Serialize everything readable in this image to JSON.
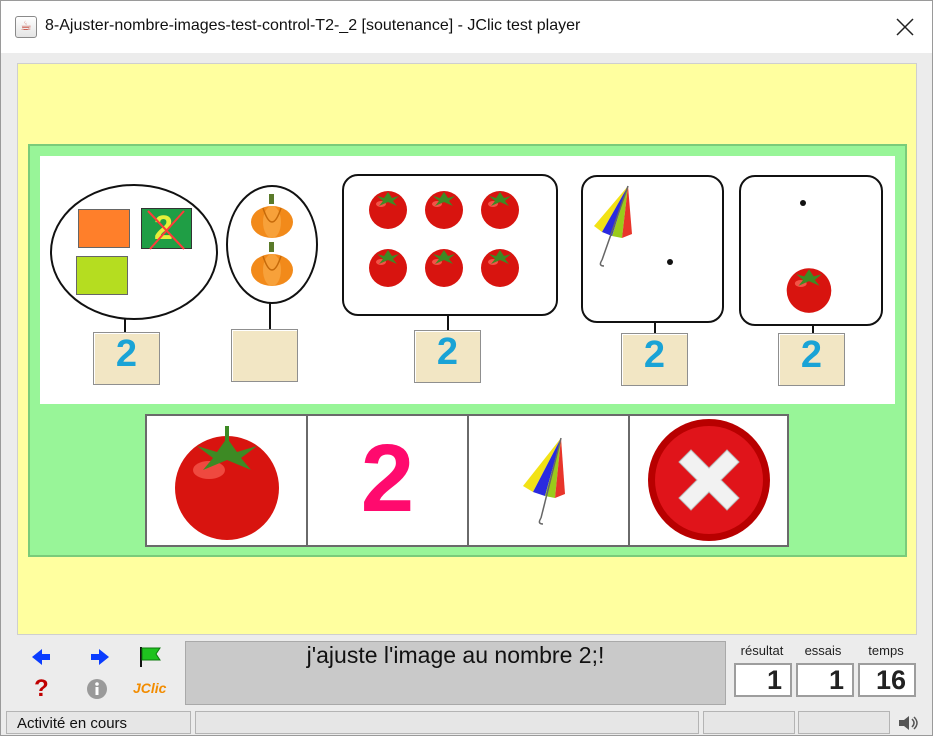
{
  "window": {
    "title": "8-Ajuster-nombre-images-test-control-T2-_2 [soutenance] - JClic test player"
  },
  "activity": {
    "groups": [
      {
        "name": "group-1",
        "number": "2"
      },
      {
        "name": "group-2",
        "number": ""
      },
      {
        "name": "group-3",
        "number": "2"
      },
      {
        "name": "group-4",
        "number": "2"
      },
      {
        "name": "group-5",
        "number": "2"
      }
    ],
    "first_group_label": "2",
    "options": [
      {
        "name": "tomato-option",
        "icon": "tomato-icon"
      },
      {
        "name": "number-two-option",
        "label": "2",
        "color": "#ff0a6e"
      },
      {
        "name": "umbrella-option",
        "icon": "umbrella-icon"
      },
      {
        "name": "delete-option",
        "icon": "red-x-icon"
      }
    ]
  },
  "controls": {
    "message": "j'ajuste l'image au nombre 2;!",
    "logo": "JClic",
    "counters": {
      "result_label": "résultat",
      "result_value": "1",
      "tries_label": "essais",
      "tries_value": "1",
      "time_label": "temps",
      "time_value": "16"
    }
  },
  "status": {
    "text": "Activité en cours"
  },
  "colors": {
    "stage": "#ffff9f",
    "board": "#98f598",
    "number": "#1aa3d6",
    "nav_arrow": "#0a3cff",
    "help": "#c00000"
  }
}
